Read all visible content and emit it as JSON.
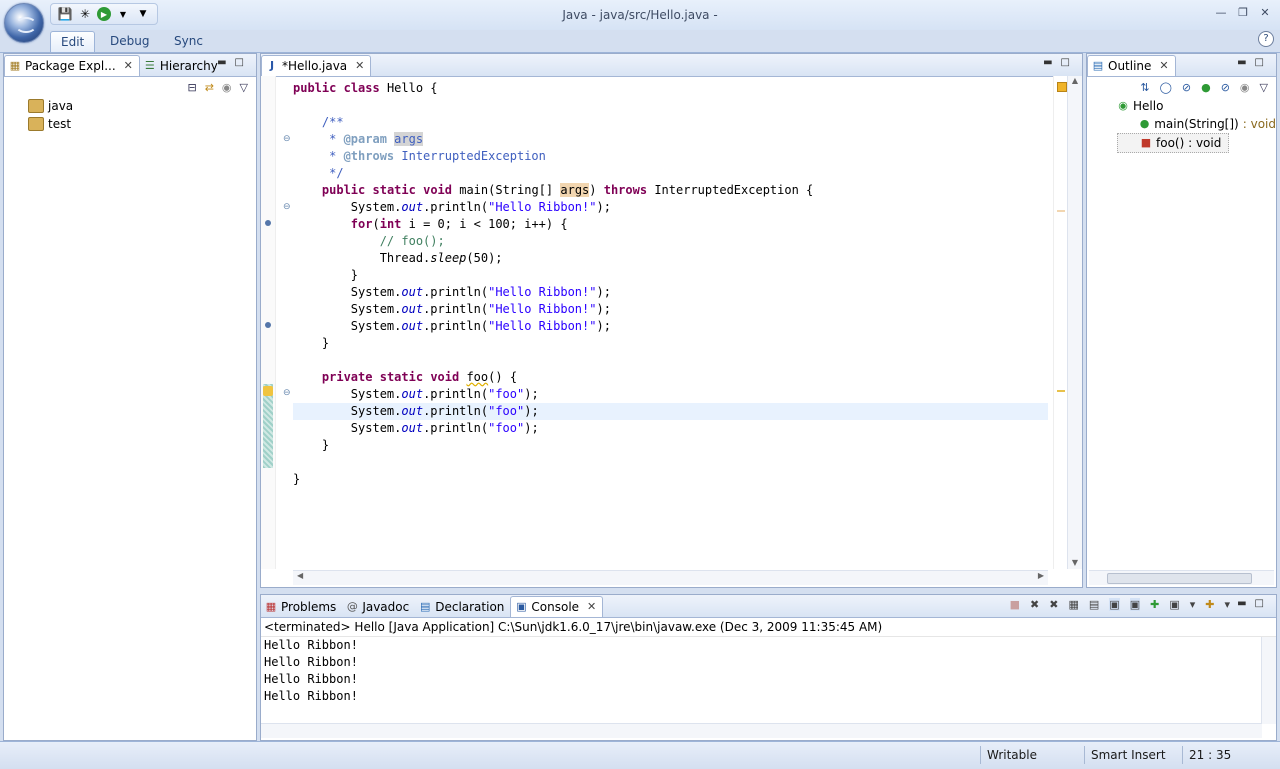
{
  "window": {
    "title": "Java - java/src/Hello.java -"
  },
  "ribbon": {
    "tabs": [
      "Edit",
      "Debug",
      "Sync"
    ],
    "active_tab": "Edit",
    "help": "?"
  },
  "package_explorer": {
    "tabs": [
      "Package Expl...",
      "Hierarchy"
    ],
    "items": [
      "java",
      "test"
    ]
  },
  "editor": {
    "tab_label": "*Hello.java"
  },
  "outline": {
    "tab_label": "Outline",
    "root": "Hello",
    "members": [
      "main(String[])",
      "foo() : void"
    ],
    "main_suffix": " : void"
  },
  "bottom_panel": {
    "tabs": [
      "Problems",
      "Javadoc",
      "Declaration",
      "Console"
    ],
    "active_tab": "Console",
    "console_header": "<terminated> Hello [Java Application] C:\\Sun\\jdk1.6.0_17\\jre\\bin\\javaw.exe (Dec 3, 2009 11:35:45 AM)",
    "output_lines": [
      "Hello Ribbon!",
      "Hello Ribbon!",
      "Hello Ribbon!",
      "Hello Ribbon!"
    ]
  },
  "status_bar": {
    "mode": "Writable",
    "insert_mode": "Smart Insert",
    "position": "21 : 35"
  },
  "colors": {
    "keyword": "#7f0055",
    "string": "#2a00ff",
    "javadoc": "#3f5fbf",
    "field": "#0000c0",
    "accent": "#9db4d8"
  }
}
